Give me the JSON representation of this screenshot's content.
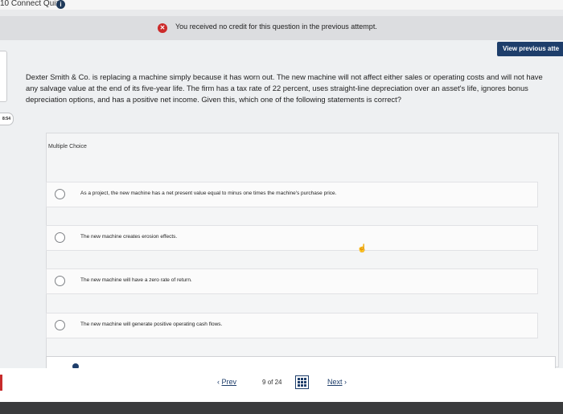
{
  "app": {
    "title": "10 Connect Quiz"
  },
  "notice": {
    "message": "You received no credit for this question in the previous attempt."
  },
  "view_previous": {
    "label": "View previous atte"
  },
  "timer": {
    "text": "8:54"
  },
  "question": {
    "text": "Dexter Smith & Co. is replacing a machine simply because it has worn out. The new machine will not affect either sales or operating costs and will not have any salvage value at the end of its five-year life. The firm has a tax rate of 22 percent, uses straight-line depreciation over an asset's life, ignores bonus depreciation options, and has a positive net income. Given this, which one of the following statements is correct?"
  },
  "multiple_choice": {
    "label": "Multiple Choice",
    "options": [
      {
        "text": "As a project, the new machine has a net present value equal to minus one times the machine's purchase price."
      },
      {
        "text": "The new machine creates erosion effects."
      },
      {
        "text": "The new machine will have a zero rate of return."
      },
      {
        "text": "The new machine will generate positive operating cash flows."
      }
    ]
  },
  "nav": {
    "prev_label": "Prev",
    "page_current": "9",
    "page_of": "of",
    "page_total": "24",
    "next_label": "Next"
  },
  "colors": {
    "accent": "#1e3e6b",
    "error": "#cc2a2a"
  },
  "icons": {
    "info": "info-icon",
    "error": "x-circle-icon",
    "grid": "grid-icon",
    "prev": "chevron-left-icon",
    "next": "chevron-right-icon"
  }
}
